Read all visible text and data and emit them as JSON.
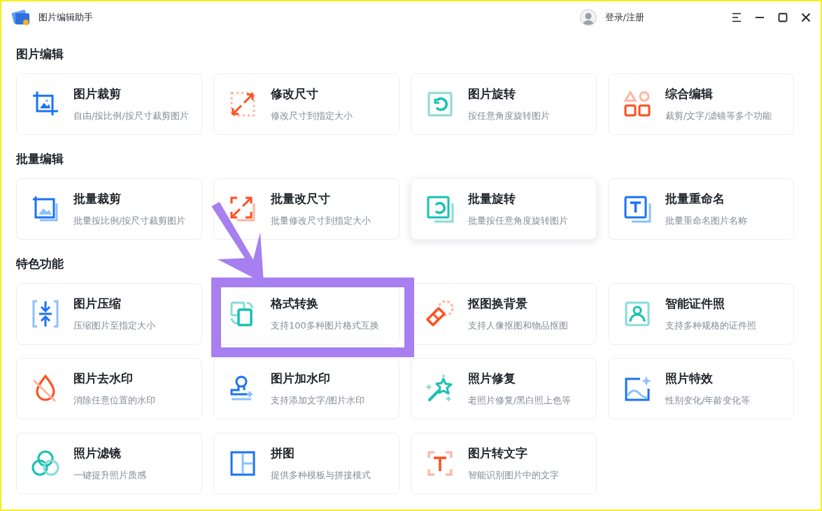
{
  "window": {
    "title": "图片编辑助手",
    "login": "登录/注册"
  },
  "sections": [
    {
      "title": "图片编辑",
      "cards": [
        {
          "kind": "crop",
          "title": "图片裁剪",
          "description": "自由/按比例/按尺寸裁剪图片",
          "hovered": false
        },
        {
          "kind": "resize",
          "title": "修改尺寸",
          "description": "修改尺寸到指定大小",
          "hovered": false
        },
        {
          "kind": "rotate",
          "title": "图片旋转",
          "description": "按任意角度旋转图片",
          "hovered": false
        },
        {
          "kind": "shapes",
          "title": "综合编辑",
          "description": "裁剪/文字/滤镜等多个功能",
          "hovered": false
        }
      ]
    },
    {
      "title": "批量编辑",
      "cards": [
        {
          "kind": "batch-crop",
          "title": "批量裁剪",
          "description": "批量按比例/按尺寸裁剪图片",
          "hovered": false
        },
        {
          "kind": "batch-resize",
          "title": "批量改尺寸",
          "description": "批量修改尺寸到指定大小",
          "hovered": false
        },
        {
          "kind": "batch-rotate",
          "title": "批量旋转",
          "description": "批量按任意角度旋转图片",
          "hovered": true
        },
        {
          "kind": "rename",
          "title": "批量重命名",
          "description": "批量重命名图片名称",
          "hovered": false
        }
      ]
    },
    {
      "title": "特色功能",
      "cards": [
        {
          "kind": "compress",
          "title": "图片压缩",
          "description": "压缩图片至指定大小",
          "hovered": false
        },
        {
          "kind": "convert",
          "title": "格式转换",
          "description": "支持100多种图片格式互换",
          "hovered": false
        },
        {
          "kind": "cutout",
          "title": "抠图换背景",
          "description": "支持人像抠图和物品抠图",
          "hovered": false
        },
        {
          "kind": "id-photo",
          "title": "智能证件照",
          "description": "支持多种规格的证件照",
          "hovered": false
        },
        {
          "kind": "dewatermark",
          "title": "图片去水印",
          "description": "消除任意位置的水印",
          "hovered": false
        },
        {
          "kind": "watermark",
          "title": "图片加水印",
          "description": "支持添加文字/图片水印",
          "hovered": false
        },
        {
          "kind": "repair",
          "title": "照片修复",
          "description": "老照片修复/黑白照上色等",
          "hovered": false
        },
        {
          "kind": "effects",
          "title": "照片特效",
          "description": "性别变化/年龄变化等",
          "hovered": false
        },
        {
          "kind": "filter",
          "title": "照片滤镜",
          "description": "一键提升照片质感",
          "hovered": false
        },
        {
          "kind": "collage",
          "title": "拼图",
          "description": "提供多种模板与拼接模式",
          "hovered": false
        },
        {
          "kind": "ocr",
          "title": "图片转文字",
          "description": "智能识别图片中的文字",
          "hovered": false
        }
      ]
    }
  ],
  "annotation_arrow": {
    "color": "#a77ff0"
  },
  "highlight_frame": {
    "color": "#a77ff0"
  }
}
